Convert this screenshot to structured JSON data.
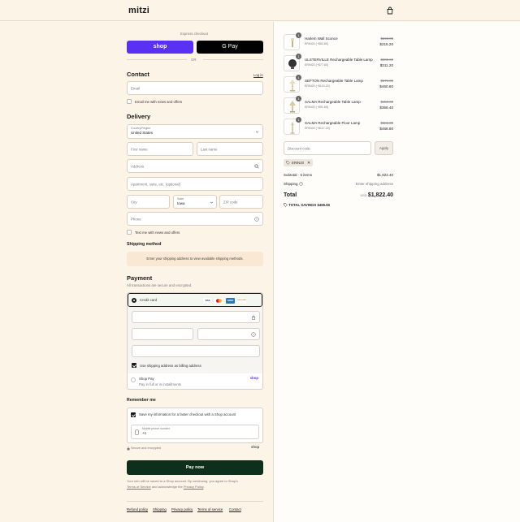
{
  "header": {
    "logo": "mitzi",
    "cart_icon": "shopping-bag-icon"
  },
  "express": {
    "label": "Express checkout",
    "shop_pay": "shop",
    "google_pay": "G Pay",
    "or": "OR"
  },
  "contact": {
    "title": "Contact",
    "login": "Log in",
    "email_placeholder": "Email",
    "email_news": "Email me with news and offers"
  },
  "delivery": {
    "title": "Delivery",
    "country_label": "Country/Region",
    "country_value": "United States",
    "first_name": "First name",
    "last_name": "Last name",
    "address": "Address",
    "apartment": "Apartment, suite, etc. (optional)",
    "city": "City",
    "state_label": "State",
    "state_value": "Iowa",
    "zip": "ZIP code",
    "phone": "Phone",
    "text_news": "Text me with news and offers"
  },
  "shipping": {
    "title": "Shipping method",
    "notice": "Enter your shipping address to view available shipping methods."
  },
  "payment": {
    "title": "Payment",
    "subtitle": "All transactions are secure and encrypted.",
    "credit_card": "Credit card",
    "cards": [
      "VISA",
      "MC",
      "AMEX",
      "DISCOVER"
    ],
    "billing_same": "Use shipping address as billing address",
    "shop_pay_label": "Shop Pay",
    "shop_pay_sub": "Pay in full or in installments",
    "shop_pay_logo": "shop"
  },
  "remember": {
    "title": "Remember me",
    "save_info": "Save my information for a faster checkout with a Shop account",
    "mobile_label": "Mobile phone number",
    "mobile_value": "+1",
    "secure": "Secure and encrypted",
    "shop_logo": "shop"
  },
  "pay_now": "Pay now",
  "legal": {
    "line1": "Your info will be saved to a Shop account. By continuing, you agree to Shop's",
    "terms": "Terms of Service",
    "and": " and acknowledge the ",
    "privacy": "Privacy Policy",
    "end": "."
  },
  "footer_links": [
    "Refund policy",
    "Shipping",
    "Privacy policy",
    "Terms of service",
    "Contact"
  ],
  "order": {
    "items": [
      {
        "qty": "1",
        "name": "Harlem Wall Sconce",
        "discount": "ERIN20 (−$53.80)",
        "old": "$269.00",
        "price": "$215.20"
      },
      {
        "qty": "1",
        "name": "ULSTERVILLE Rechargeable Table Lamp",
        "discount": "ERIN20 (−$77.80)",
        "old": "$389.00",
        "price": "$311.20"
      },
      {
        "qty": "1",
        "name": "SEFTON Rechargeable Table Lamp",
        "discount": "ERIN20 (−$115.20)",
        "old": "$576.00",
        "price": "$460.80"
      },
      {
        "qty": "1",
        "name": "SALMA Rechargeable Table Lamp",
        "discount": "ERIN20 (−$91.60)",
        "old": "$458.00",
        "price": "$366.40"
      },
      {
        "qty": "1",
        "name": "SALMA Rechargeable Floor Lamp",
        "discount": "ERIN20 (−$117.20)",
        "old": "$586.00",
        "price": "$468.80"
      }
    ],
    "discount_placeholder": "Discount code",
    "apply": "Apply",
    "code_tag": "ERIN20",
    "subtotal_label": "Subtotal · 5 items",
    "subtotal": "$1,822.40",
    "shipping_label": "Shipping",
    "shipping_value": "Enter shipping address",
    "total_label": "Total",
    "currency": "USD",
    "total": "$1,822.40",
    "savings_label": "TOTAL SAVINGS",
    "savings": "$455.60"
  }
}
